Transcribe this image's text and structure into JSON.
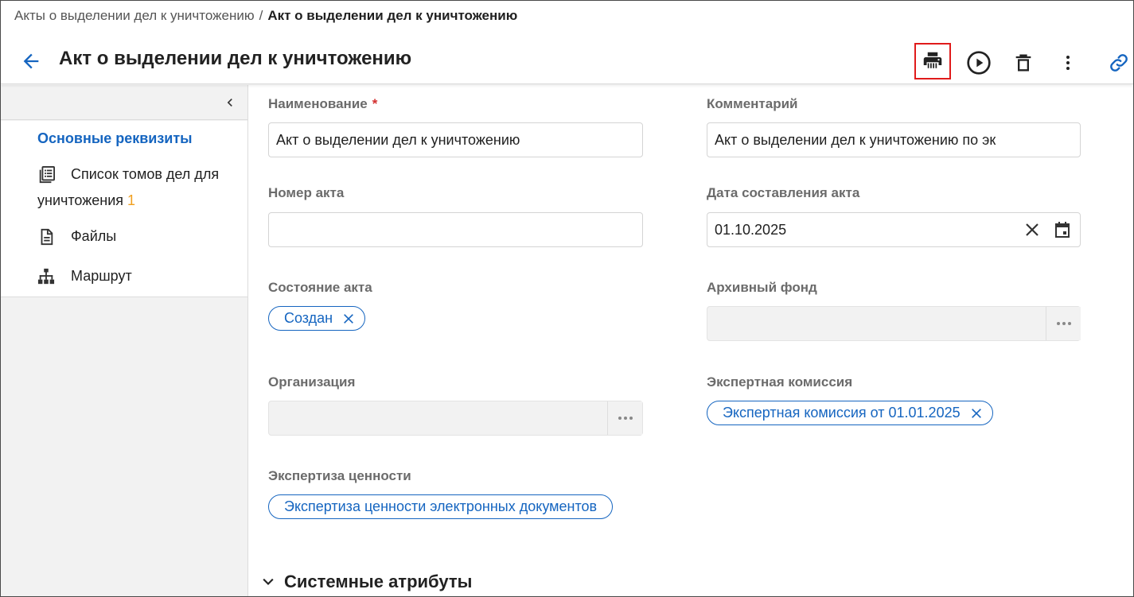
{
  "breadcrumb": {
    "parent": "Акты о выделении дел к уничтожению",
    "separator": "/",
    "current": "Акт о выделении дел к уничтожению"
  },
  "header": {
    "title": "Акт о выделении дел к уничтожению",
    "icons": [
      "arrow-left-icon",
      "printer-icon",
      "play-circle-icon",
      "trash-icon",
      "more-vertical-icon",
      "link-icon"
    ]
  },
  "sidebar": {
    "items": [
      {
        "label": "Основные реквизиты",
        "icon": null,
        "active": true
      },
      {
        "label": "Список томов дел для",
        "label2": "уничтожения",
        "counter": "1",
        "icon": "list-icon"
      },
      {
        "label": "Файлы",
        "icon": "document-icon"
      },
      {
        "label": "Маршрут",
        "icon": "hierarchy-icon"
      }
    ]
  },
  "form": {
    "name": {
      "label": "Наименование",
      "required_mark": "*",
      "value": "Акт о выделении дел к уничтожению"
    },
    "comment": {
      "label": "Комментарий",
      "value": "Акт о выделении дел к уничтожению по эк"
    },
    "act_number": {
      "label": "Номер акта",
      "value": ""
    },
    "act_date": {
      "label": "Дата составления акта",
      "value": "01.10.2025"
    },
    "act_state": {
      "label": "Состояние акта",
      "chip": "Создан"
    },
    "archive_fund": {
      "label": "Архивный фонд",
      "value": ""
    },
    "organization": {
      "label": "Организация",
      "value": ""
    },
    "expert_commission": {
      "label": "Экспертная комиссия",
      "chip": "Экспертная комиссия от 01.01.2025"
    },
    "value_expertise": {
      "label": "Экспертиза ценности",
      "chip": "Экспертиза ценности электронных документов"
    }
  },
  "sections": {
    "system_attributes": "Системные атрибуты"
  },
  "colors": {
    "accent": "#1565c0",
    "required": "#d32f2f",
    "highlight_border": "#e01b1b",
    "counter": "#f0a020"
  }
}
